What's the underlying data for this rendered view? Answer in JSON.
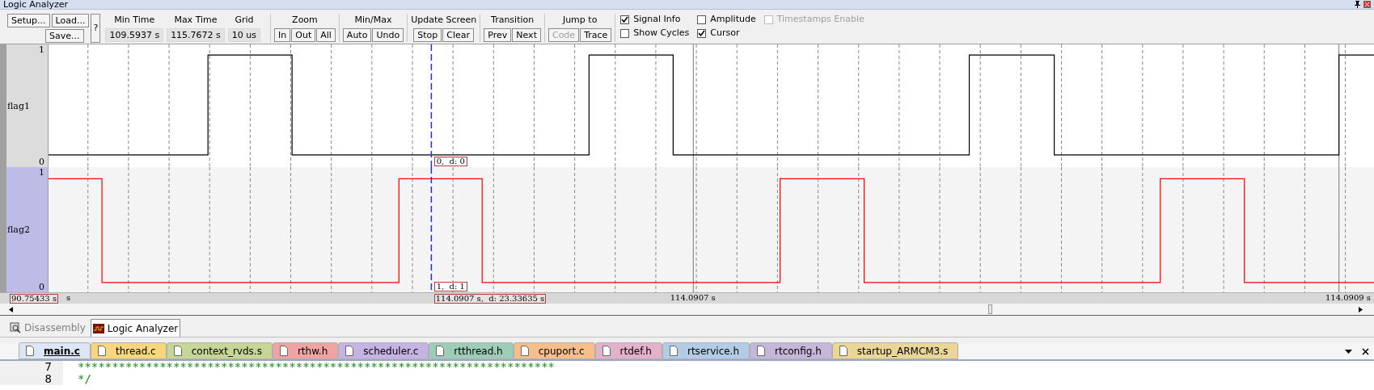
{
  "window": {
    "title": "Logic Analyzer"
  },
  "toolbar": {
    "file_buttons": [
      {
        "label": "Setup..."
      },
      {
        "label": "Load..."
      },
      {
        "label": "Save..."
      }
    ],
    "help_button": "?",
    "readouts": [
      {
        "label": "Min Time",
        "value": "109.5937 s"
      },
      {
        "label": "Max Time",
        "value": "115.7672 s"
      },
      {
        "label": "Grid",
        "value": "10 us"
      }
    ],
    "groups": [
      {
        "title": "Zoom",
        "buttons": [
          {
            "label": "In",
            "disabled": false
          },
          {
            "label": "Out",
            "disabled": false
          },
          {
            "label": "All",
            "disabled": false
          }
        ]
      },
      {
        "title": "Min/Max",
        "buttons": [
          {
            "label": "Auto",
            "disabled": false
          },
          {
            "label": "Undo",
            "disabled": false
          }
        ]
      },
      {
        "title": "Update Screen",
        "buttons": [
          {
            "label": "Stop",
            "disabled": false
          },
          {
            "label": "Clear",
            "disabled": false
          }
        ]
      },
      {
        "title": "Transition",
        "buttons": [
          {
            "label": "Prev",
            "disabled": false
          },
          {
            "label": "Next",
            "disabled": false
          }
        ]
      },
      {
        "title": "Jump to",
        "buttons": [
          {
            "label": "Code",
            "disabled": true
          },
          {
            "label": "Trace",
            "disabled": false
          }
        ]
      }
    ],
    "checkboxes": [
      {
        "label": "Signal Info",
        "checked": true,
        "disabled": false
      },
      {
        "label": "Show Cycles",
        "checked": false,
        "disabled": false
      },
      {
        "label": "Amplitude",
        "checked": false,
        "disabled": false
      },
      {
        "label": "Cursor",
        "checked": true,
        "disabled": false
      },
      {
        "label": "Timestamps Enable",
        "checked": false,
        "disabled": true
      }
    ]
  },
  "signals": [
    {
      "name": "flag1",
      "high": "1",
      "low": "0",
      "selected": false,
      "color": "#000000",
      "cursor_value": "0,  d: 0"
    },
    {
      "name": "flag2",
      "high": "1",
      "low": "0",
      "selected": true,
      "color": "#ff0000",
      "cursor_value": "1,  d: 1"
    }
  ],
  "time_axis": {
    "start": "90.75433 s",
    "unit": "s",
    "cursor": "114.0907 s,  d: 23.33635 s",
    "ticks": [
      "114.0907 s",
      "114.0909 s"
    ]
  },
  "view_tabs": [
    {
      "label": "Disassembly",
      "selected": false
    },
    {
      "label": "Logic Analyzer",
      "selected": true
    }
  ],
  "file_tabs": [
    {
      "label": "main.c",
      "selected": true,
      "color": "#dce6f4"
    },
    {
      "label": "thread.c",
      "selected": false,
      "color": "#f8d67c"
    },
    {
      "label": "context_rvds.s",
      "selected": false,
      "color": "#c6d697"
    },
    {
      "label": "rthw.h",
      "selected": false,
      "color": "#f0a3a3"
    },
    {
      "label": "scheduler.c",
      "selected": false,
      "color": "#c5b3e4"
    },
    {
      "label": "rtthread.h",
      "selected": false,
      "color": "#9dcdb6"
    },
    {
      "label": "cpuport.c",
      "selected": false,
      "color": "#f6be8a"
    },
    {
      "label": "rtdef.h",
      "selected": false,
      "color": "#e3b1ca"
    },
    {
      "label": "rtservice.h",
      "selected": false,
      "color": "#b3cbe4"
    },
    {
      "label": "rtconfig.h",
      "selected": false,
      "color": "#c4b7d7"
    },
    {
      "label": "startup_ARMCM3.s",
      "selected": false,
      "color": "#ead697"
    }
  ],
  "code": [
    {
      "line": "7",
      "text": "**********************************************************************"
    },
    {
      "line": "8",
      "text": "*/"
    }
  ]
}
